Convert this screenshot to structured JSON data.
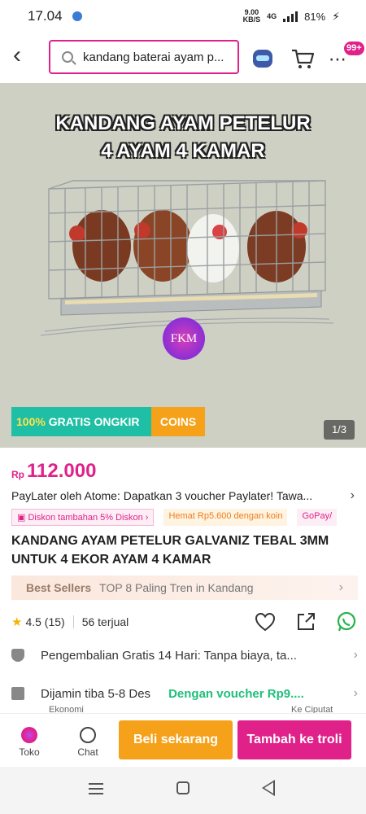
{
  "status_bar": {
    "time": "17.04",
    "net_speed_value": "9.00",
    "net_speed_unit": "KB/S",
    "network": "4G",
    "battery": "81%"
  },
  "header": {
    "search_text": "kandang baterai ayam p...",
    "cart_badge": "99+"
  },
  "hero": {
    "title_line1": "KANDANG AYAM PETELUR",
    "title_line2": "4 AYAM 4 KAMAR",
    "watermark": "FKM",
    "promo_green_prefix": "100%",
    "promo_green_text": " GRATIS ONGKIR",
    "promo_coins": "COINS",
    "pager": "1/3"
  },
  "product": {
    "currency": "Rp",
    "price": "112.000",
    "paylater": "PayLater oleh Atome: Dapatkan 3 voucher Paylater! Tawa...",
    "chip_discount": "Diskon tambahan 5% Diskon",
    "chip_hemat": "Hemat Rp5.600 dengan koin",
    "chip_gopay": "GoPay/",
    "title": "KANDANG AYAM PETELUR GALVANIZ TEBAL 3MM UNTUK 4 EKOR AYAM 4 KAMAR",
    "bestseller_label": "Best Sellers",
    "bestseller_text": "TOP 8 Paling Tren in Kandang",
    "rating": "4.5 (15)",
    "sold": "56 terjual",
    "returns": "Pengembalian Gratis 14 Hari: Tanpa biaya, ta...",
    "delivery": "Dijamin tiba 5-8 Des",
    "voucher": "Dengan voucher Rp9....",
    "delivery_sub_left": "Ekonomi",
    "delivery_sub_right": "Ke Ciputat"
  },
  "bottom_bar": {
    "store_label": "Toko",
    "chat_label": "Chat",
    "buy_now": "Beli sekarang",
    "add_to_cart": "Tambah ke troli"
  },
  "colors": {
    "brand": "#e0218a",
    "orange": "#f5a21a",
    "teal": "#1fbfa5",
    "green": "#1fbf7a"
  }
}
